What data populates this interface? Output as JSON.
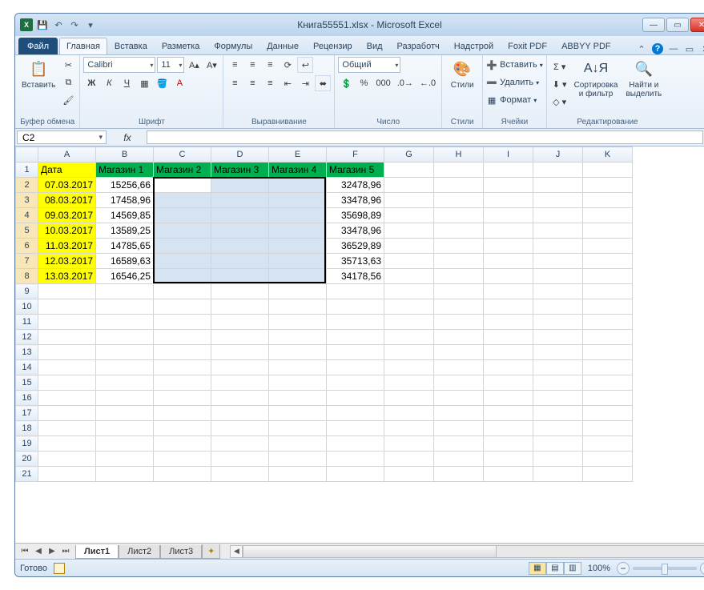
{
  "title": "Книга55551.xlsx - Microsoft Excel",
  "qat": {
    "save": "💾",
    "undo": "↶",
    "redo": "↷",
    "more": "▾"
  },
  "tabs": {
    "file": "Файл",
    "items": [
      "Главная",
      "Вставка",
      "Разметка",
      "Формулы",
      "Данные",
      "Рецензир",
      "Вид",
      "Разработч",
      "Надстрой",
      "Foxit PDF",
      "ABBYY PDF"
    ],
    "active": 0
  },
  "ribbon": {
    "clipboard": {
      "paste": "Вставить",
      "cut": "✂",
      "copy": "⧉",
      "format": "🖌",
      "label": "Буфер обмена"
    },
    "font": {
      "name": "Calibri",
      "size": "11",
      "bold": "Ж",
      "italic": "К",
      "underline": "Ч",
      "label": "Шрифт"
    },
    "align": {
      "label": "Выравнивание"
    },
    "number": {
      "format": "Общий",
      "label": "Число"
    },
    "styles": {
      "label": "Стили",
      "btn": "Стили"
    },
    "cells": {
      "insert": "Вставить",
      "delete": "Удалить",
      "format": "Формат",
      "label": "Ячейки"
    },
    "editing": {
      "sort": "Сортировка\nи фильтр",
      "find": "Найти и\nвыделить",
      "label": "Редактирование"
    }
  },
  "namebox": "C2",
  "fx_label": "fx",
  "columns": [
    "A",
    "B",
    "C",
    "D",
    "E",
    "F",
    "G",
    "H",
    "I",
    "J",
    "K"
  ],
  "headers": {
    "date": "Дата",
    "stores": [
      "Магазин 1",
      "Магазин 2",
      "Магазин 3",
      "Магазин 4",
      "Магазин 5"
    ]
  },
  "rows": [
    {
      "n": "2",
      "date": "07.03.2017",
      "b": "15256,66",
      "f": "32478,96"
    },
    {
      "n": "3",
      "date": "08.03.2017",
      "b": "17458,96",
      "f": "33478,96"
    },
    {
      "n": "4",
      "date": "09.03.2017",
      "b": "14569,85",
      "f": "35698,89"
    },
    {
      "n": "5",
      "date": "10.03.2017",
      "b": "13589,25",
      "f": "33478,96"
    },
    {
      "n": "6",
      "date": "11.03.2017",
      "b": "14785,65",
      "f": "36529,89"
    },
    {
      "n": "7",
      "date": "12.03.2017",
      "b": "16589,63",
      "f": "35713,63"
    },
    {
      "n": "8",
      "date": "13.03.2017",
      "b": "16546,25",
      "f": "34178,56"
    }
  ],
  "empty_rows": [
    "9",
    "10",
    "11",
    "12",
    "13",
    "14",
    "15",
    "16",
    "17",
    "18",
    "19",
    "20",
    "21"
  ],
  "sheets": {
    "items": [
      "Лист1",
      "Лист2",
      "Лист3"
    ],
    "active": 0
  },
  "status": {
    "ready": "Готово",
    "zoom": "100%"
  }
}
